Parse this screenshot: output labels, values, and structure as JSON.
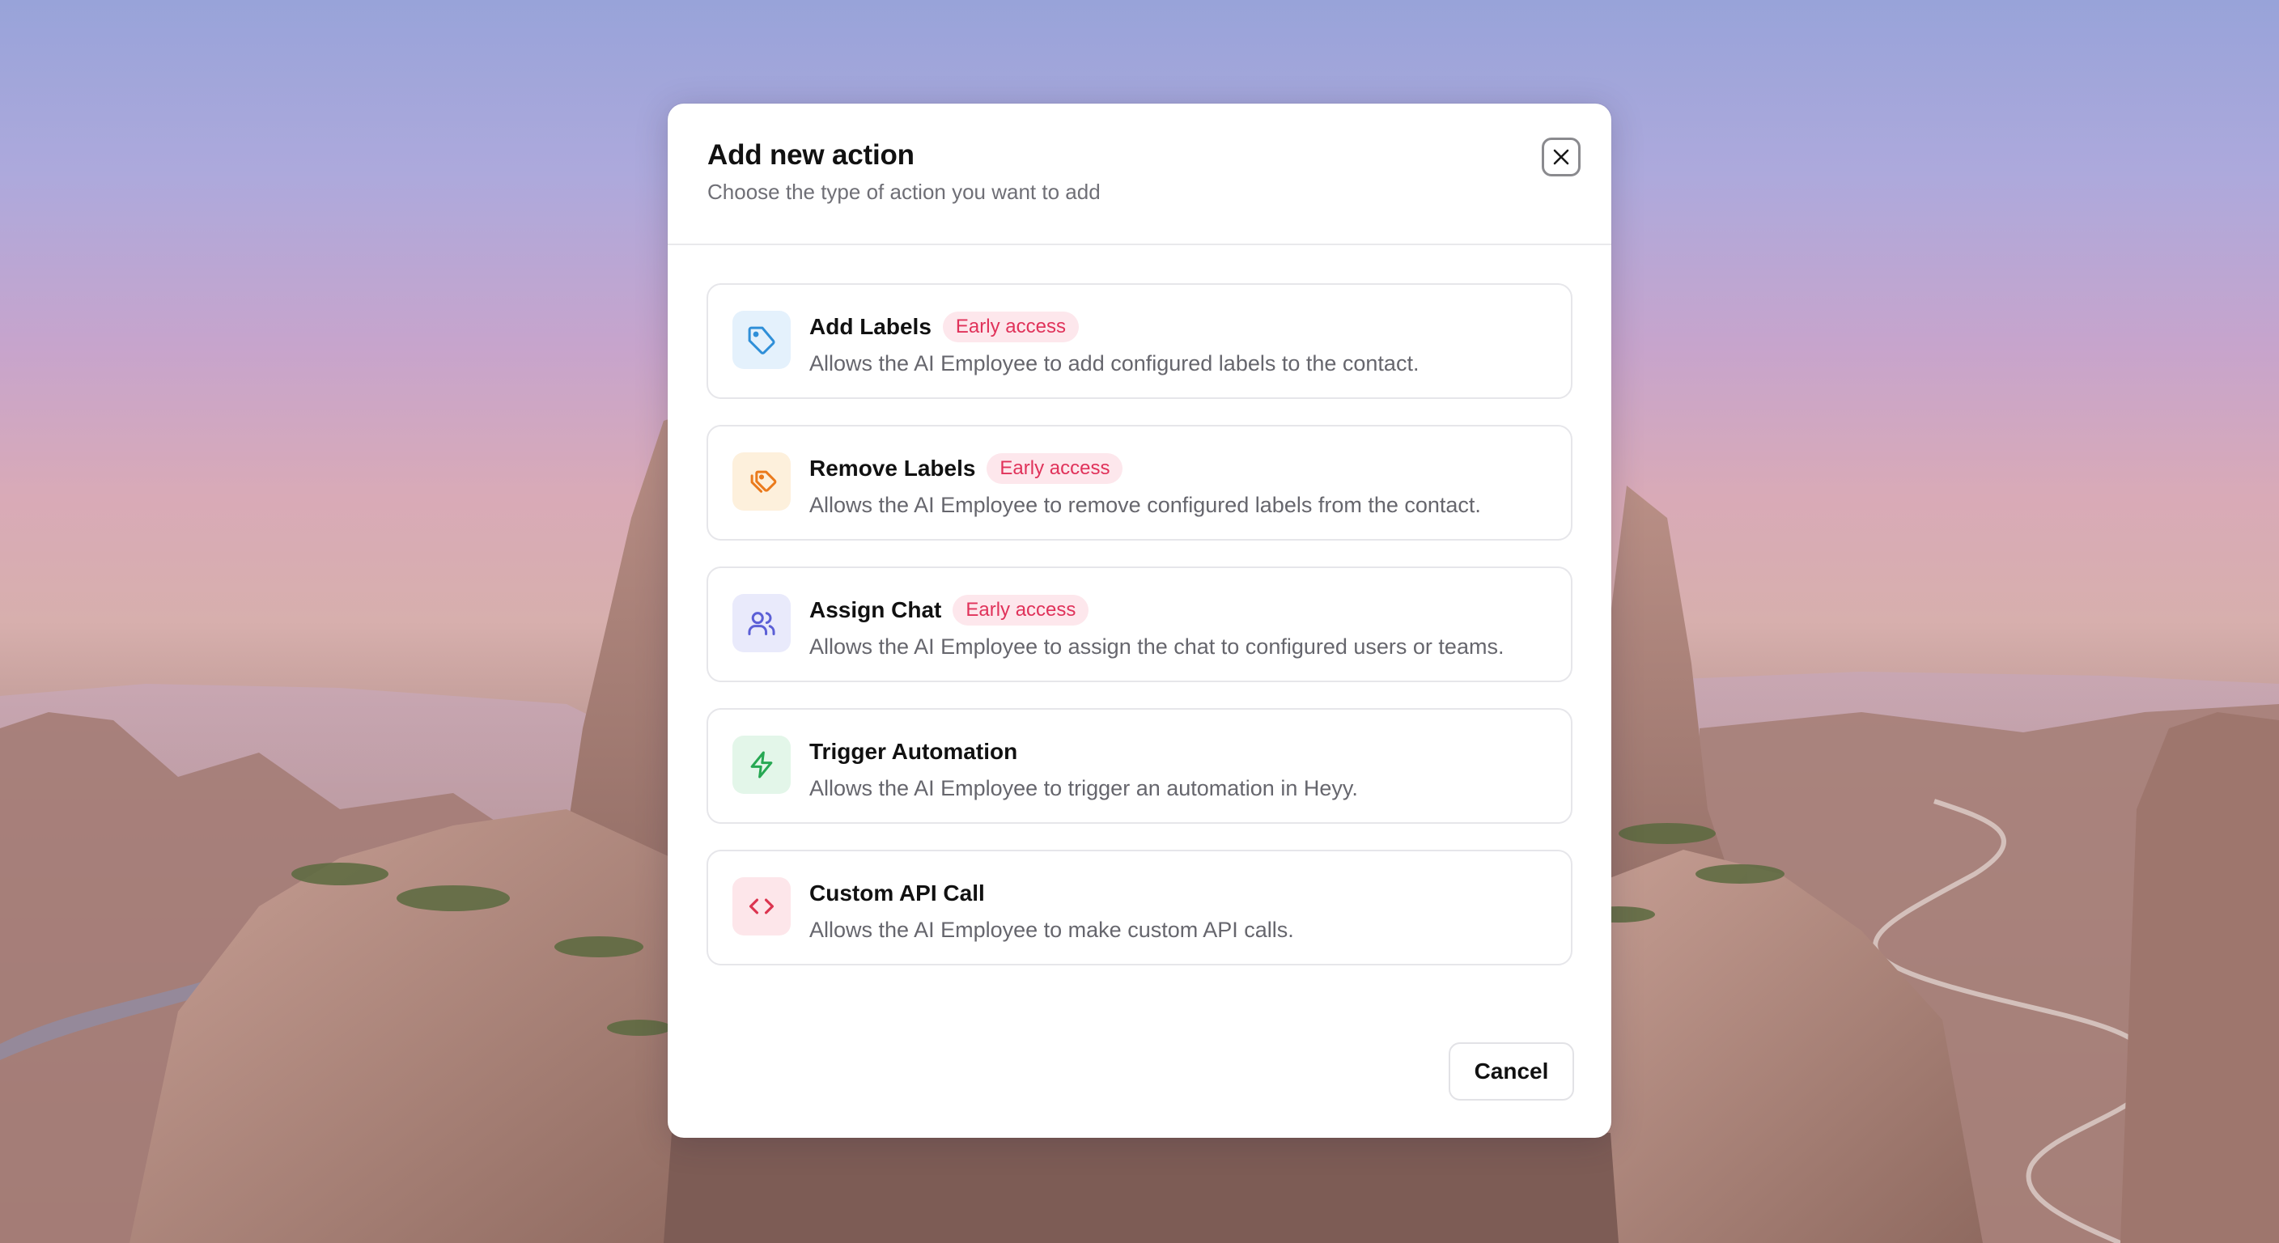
{
  "dialog": {
    "title": "Add new action",
    "subtitle": "Choose the type of action you want to add",
    "close_icon": "close-icon",
    "cancel_label": "Cancel"
  },
  "actions": [
    {
      "title": "Add Labels",
      "badge": "Early access",
      "description": "Allows the AI Employee to add configured labels to the contact.",
      "icon": "tag-icon",
      "icon_color": "#2f8fd8",
      "icon_bg": "#e4f1fc"
    },
    {
      "title": "Remove Labels",
      "badge": "Early access",
      "description": "Allows the AI Employee to remove configured labels from the contact.",
      "icon": "tags-icon",
      "icon_color": "#ea7a1c",
      "icon_bg": "#fdf0dc"
    },
    {
      "title": "Assign Chat",
      "badge": "Early access",
      "description": "Allows the AI Employee to assign the chat to configured users or teams.",
      "icon": "users-icon",
      "icon_color": "#5b5fd6",
      "icon_bg": "#e9eafb"
    },
    {
      "title": "Trigger Automation",
      "badge": "",
      "description": "Allows the AI Employee to trigger an automation in Heyy.",
      "icon": "zap-icon",
      "icon_color": "#27a853",
      "icon_bg": "#e3f6e9"
    },
    {
      "title": "Custom API Call",
      "badge": "",
      "description": "Allows the AI Employee to make custom API calls.",
      "icon": "code-icon",
      "icon_color": "#dc3550",
      "icon_bg": "#fde6ea"
    }
  ],
  "colors": {
    "badge_text": "#e0325a",
    "badge_bg": "#fde7ec"
  }
}
